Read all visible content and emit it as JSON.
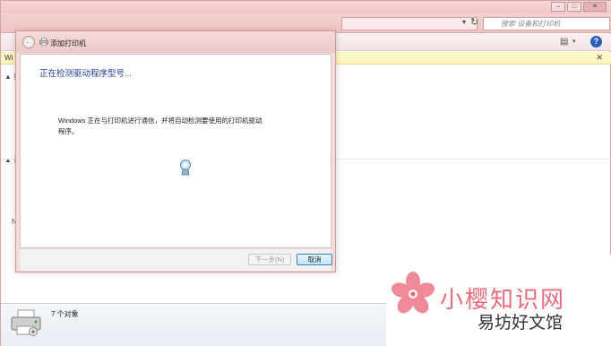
{
  "explorer": {
    "search_placeholder": "搜索 设备和打印机",
    "infobar_text": "Wi",
    "status_count": "7 个对象",
    "sidebar_markers": [
      "▲ 打",
      "▲ 设",
      "N"
    ]
  },
  "dialog": {
    "title": "添加打印机",
    "heading": "正在检测驱动程序型号...",
    "description": "Windows 正在与打印机进行通信，并将自动检测要使用的打印机驱动程序。",
    "next_button": "下一步(N)",
    "cancel_button": "取消"
  },
  "watermark": {
    "title": "小樱知识网",
    "subtitle": "易坊好文馆"
  },
  "colors": {
    "heading_blue": "#1e3f8e",
    "watermark_pink": "#e66d7c",
    "infobar_yellow": "#fdf7c3"
  }
}
